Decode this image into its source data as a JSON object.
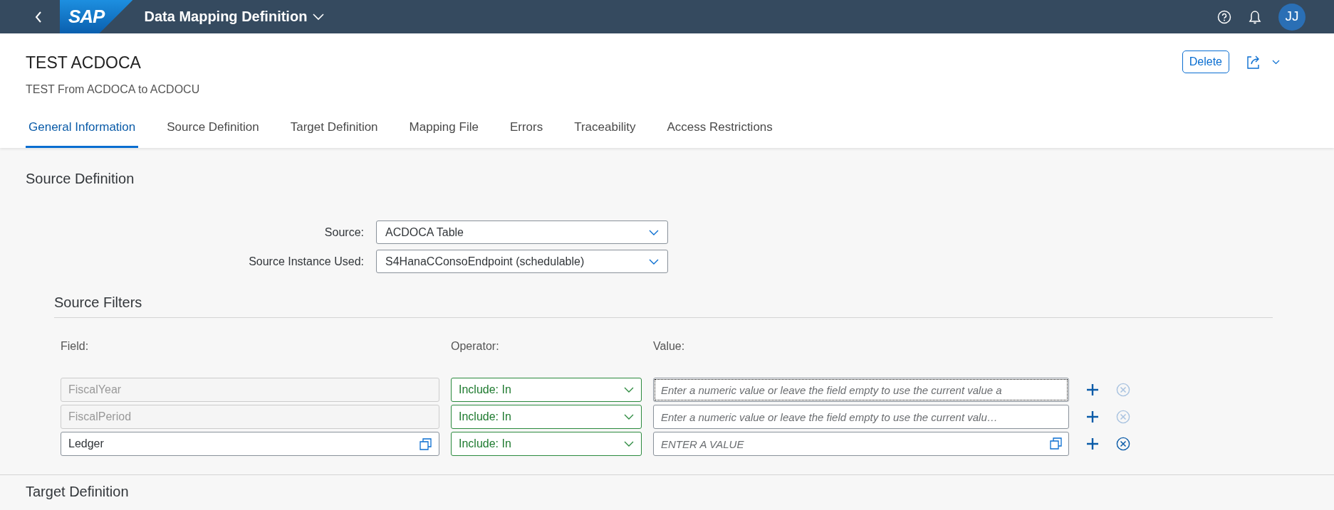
{
  "shell": {
    "logo": "SAP",
    "title": "Data Mapping Definition",
    "avatar": "JJ"
  },
  "object": {
    "title": "TEST ACDOCA",
    "subtitle": "TEST From ACDOCA to ACDOCU",
    "actions": [
      "Delete"
    ]
  },
  "tabs": [
    {
      "label": "General Information",
      "selected": true
    },
    {
      "label": "Source Definition",
      "selected": false
    },
    {
      "label": "Target Definition",
      "selected": false
    },
    {
      "label": "Mapping File",
      "selected": false
    },
    {
      "label": "Errors",
      "selected": false
    },
    {
      "label": "Traceability",
      "selected": false
    },
    {
      "label": "Access Restrictions",
      "selected": false
    }
  ],
  "source_section": {
    "title": "Source Definition",
    "fields": [
      {
        "label": "Source:",
        "value": "ACDOCA Table"
      },
      {
        "label": "Source Instance Used:",
        "value": "S4HanaCConsoEndpoint (schedulable)"
      }
    ],
    "filters": {
      "title": "Source Filters",
      "columns": [
        "Field:",
        "Operator:",
        "Value:"
      ],
      "rows": [
        {
          "field": "FiscalYear",
          "field_disabled": true,
          "field_value_help": false,
          "operator": "Include: In",
          "value_placeholder": "Enter a numeric value or leave the field empty to use the current value a",
          "value_focused": true,
          "value_help": false,
          "remove_disabled": true
        },
        {
          "field": "FiscalPeriod",
          "field_disabled": true,
          "field_value_help": false,
          "operator": "Include: In",
          "value_placeholder": "Enter a numeric value or leave the field empty to use the current valu…",
          "value_focused": false,
          "value_help": false,
          "remove_disabled": true
        },
        {
          "field": "Ledger",
          "field_disabled": false,
          "field_value_help": true,
          "operator": "Include: In",
          "value_placeholder": "ENTER A VALUE",
          "value_focused": false,
          "value_help": true,
          "remove_disabled": false
        }
      ]
    }
  },
  "next_section": {
    "title": "Target Definition"
  }
}
